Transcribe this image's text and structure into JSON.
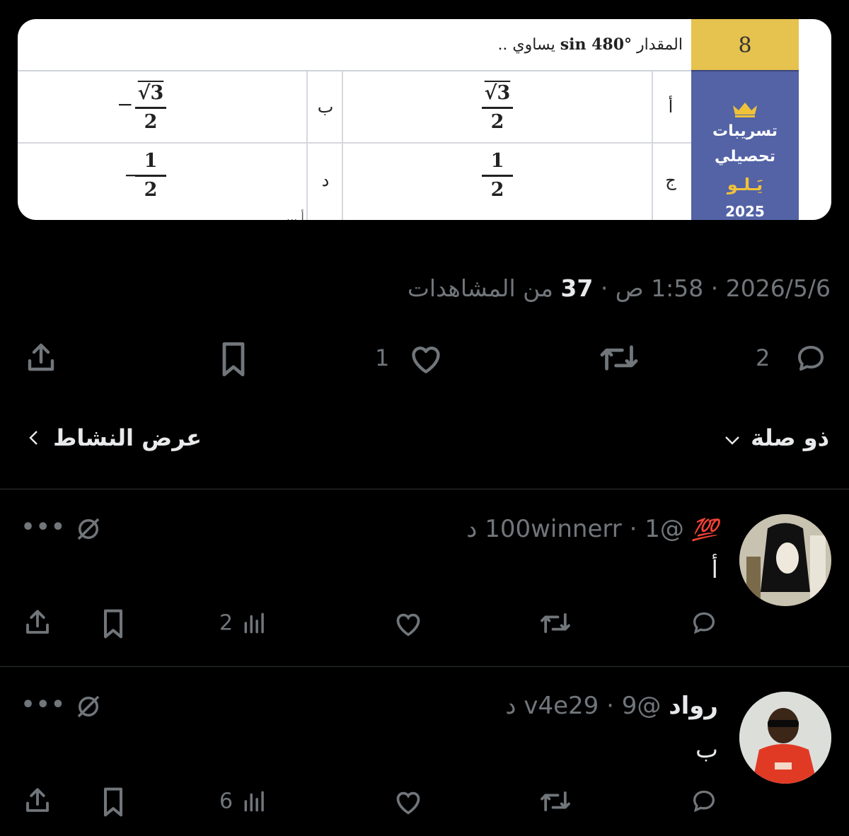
{
  "question": {
    "number": "8",
    "prefix": "المقدار",
    "expression": "sin 480°",
    "suffix": "يساوي ..",
    "options": [
      {
        "letter": "أ",
        "numerator": "√3",
        "denominator": "2",
        "sign": ""
      },
      {
        "letter": "ب",
        "numerator": "√3",
        "denominator": "2",
        "sign": "−"
      },
      {
        "letter": "ج",
        "numerator": "1",
        "denominator": "2",
        "sign": ""
      },
      {
        "letter": "د",
        "numerator": "1",
        "denominator": "2",
        "sign": "−"
      }
    ],
    "side_label": {
      "line1": "تسريبات",
      "line2": "تحصيلي",
      "line3": "يَـلـو",
      "line4": "2025"
    },
    "cut_text": "... أ"
  },
  "tweet_meta": {
    "date_time": "2026/5/6 · 1:58 ص · ",
    "views_count": "37",
    "views_label": " من المشاهدات"
  },
  "actions": {
    "replies": "2",
    "likes": "1"
  },
  "related": {
    "label": "ذو صلة",
    "activity_label": "عرض النشاط"
  },
  "replies": [
    {
      "name_emoji": "💯",
      "handle": "@100winnerr",
      "time": "1 د",
      "text": "أ",
      "views": "2"
    },
    {
      "name": "رواد",
      "handle": "@v4e29",
      "time": "9 د",
      "text": "ب",
      "views": "6"
    }
  ],
  "colors": {
    "background": "#000000",
    "text_primary": "#e7e9ea",
    "text_secondary": "#71767b",
    "divider": "#2f3336",
    "card_gold": "#e6c24e",
    "card_blue": "#5463a6"
  }
}
